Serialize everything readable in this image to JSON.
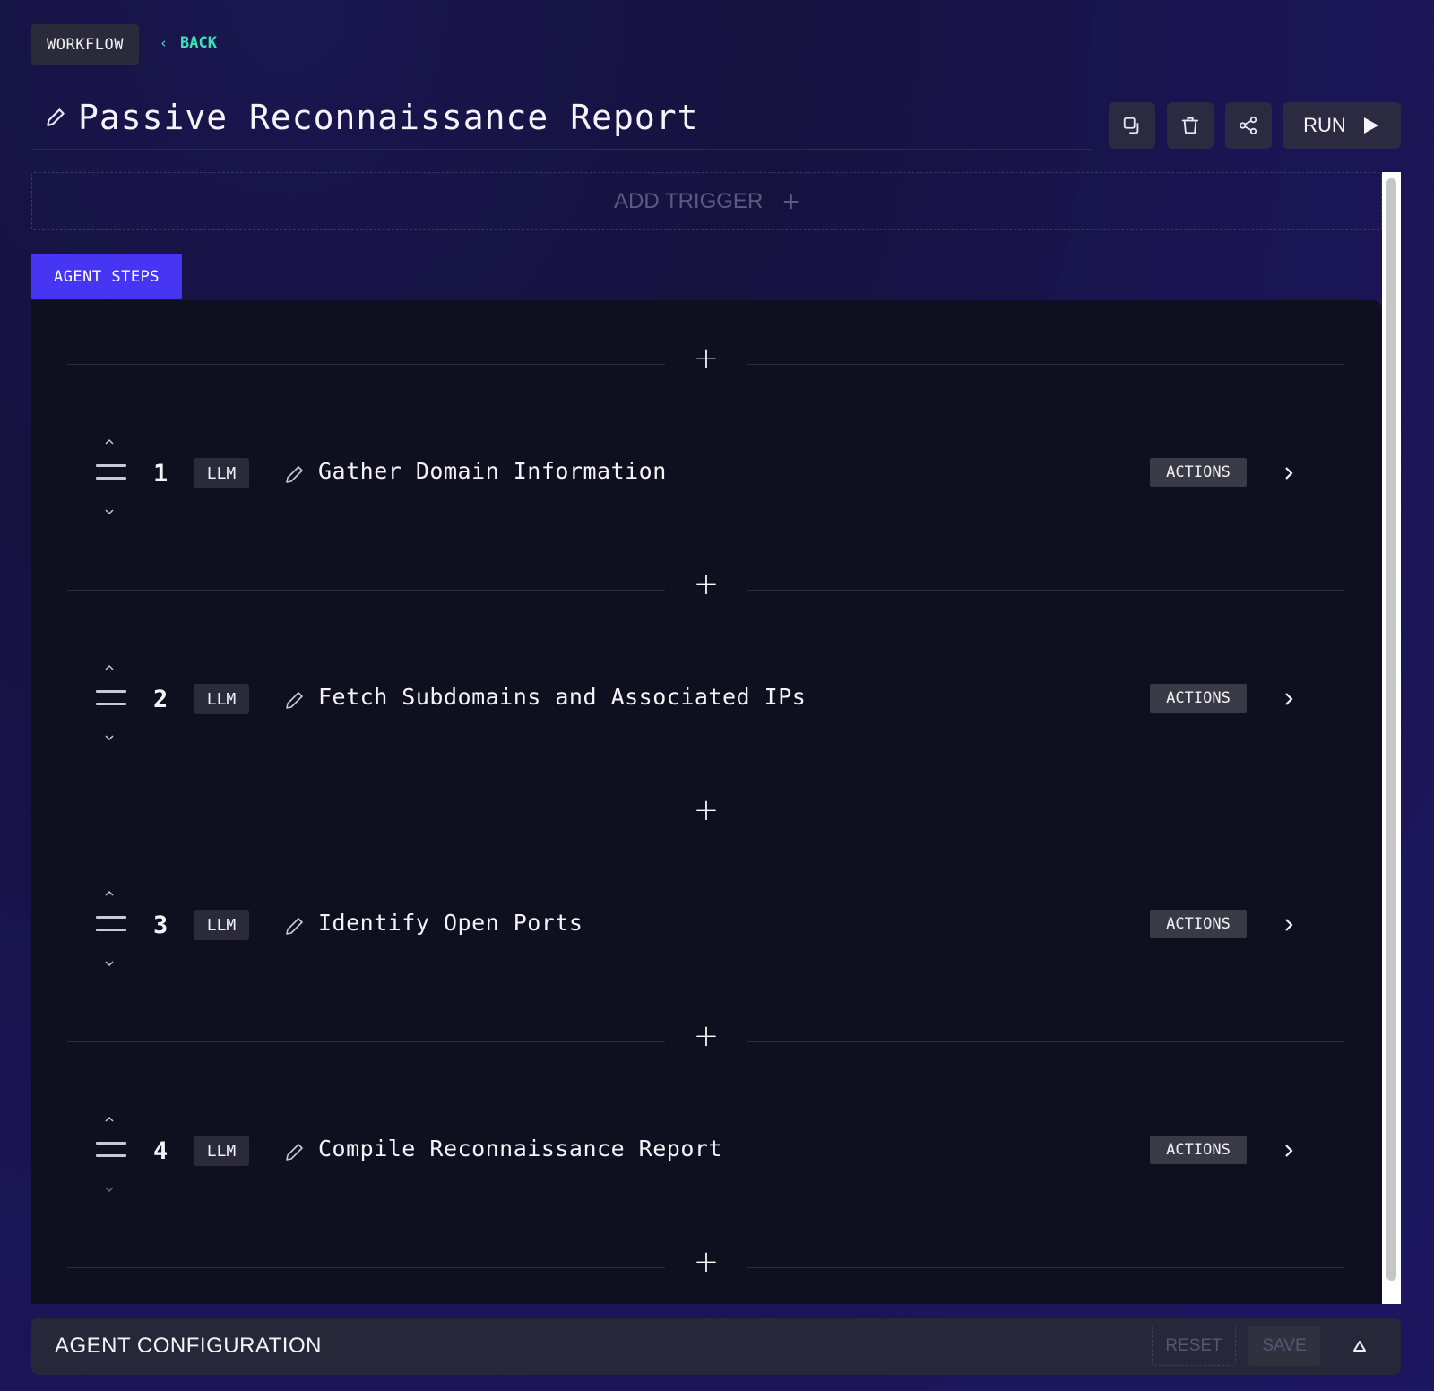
{
  "header": {
    "workflow_label": "WORKFLOW",
    "back_label": "BACK",
    "back_chevron": "‹",
    "title": "Passive Reconnaissance Report"
  },
  "toolbar": {
    "duplicate_icon": "copy-icon",
    "delete_icon": "trash-icon",
    "share_icon": "share-icon",
    "run_label": "RUN",
    "run_icon": "play-icon"
  },
  "trigger": {
    "add_label": "ADD TRIGGER",
    "plus": "+"
  },
  "tabs": {
    "agent_steps": "AGENT STEPS"
  },
  "steps": [
    {
      "number": "1",
      "type": "LLM",
      "title": "Gather Domain Information",
      "actions_label": "ACTIONS"
    },
    {
      "number": "2",
      "type": "LLM",
      "title": "Fetch Subdomains and Associated IPs",
      "actions_label": "ACTIONS"
    },
    {
      "number": "3",
      "type": "LLM",
      "title": "Identify Open Ports",
      "actions_label": "ACTIONS"
    },
    {
      "number": "4",
      "type": "LLM",
      "title": "Compile Reconnaissance Report",
      "actions_label": "ACTIONS"
    }
  ],
  "add_step_symbol": "+",
  "config": {
    "title": "AGENT CONFIGURATION",
    "reset_label": "RESET",
    "save_label": "SAVE"
  },
  "colors": {
    "accent": "#4636f4",
    "back_link": "#3ee0b8",
    "panel_bg": "#0e1020",
    "chip_bg": "#2b2a3a"
  }
}
